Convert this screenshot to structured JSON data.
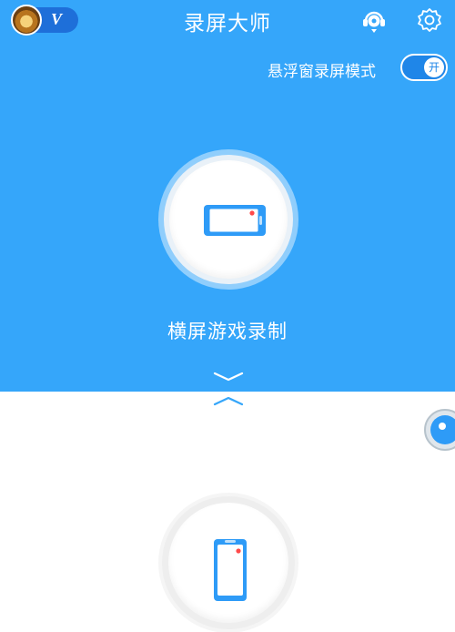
{
  "header": {
    "title": "录屏大师",
    "vip_badge": "V",
    "avatar_icon": "avatar-icon",
    "service_icon": "customer-service-icon",
    "settings_icon": "gear-icon"
  },
  "floating_mode": {
    "label": "悬浮窗录屏模式",
    "toggle_text": "开",
    "enabled": true
  },
  "landscape": {
    "label": "横屏游戏录制",
    "icon": "landscape-phone-icon"
  },
  "portrait": {
    "icon": "portrait-phone-icon"
  },
  "colors": {
    "primary_blue": "#35a6fa",
    "record_dot": "#ff4a4a",
    "phone_blue": "#2e9bf7"
  }
}
